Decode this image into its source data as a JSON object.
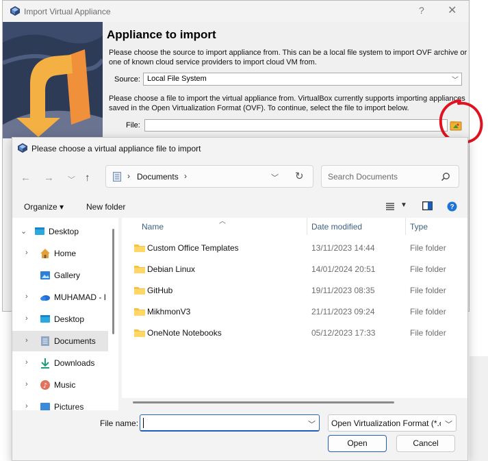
{
  "wizard": {
    "title": "Import Virtual Appliance",
    "help_label": "?",
    "close_label": "✕",
    "heading": "Appliance to import",
    "source_description": "Please choose the source to import appliance from. This can be a local file system to import OVF archive or one of known cloud service providers to import cloud VM from.",
    "source_label": "Source:",
    "source_value": "Local File System",
    "file_description": "Please choose a file to import the virtual appliance from. VirtualBox currently supports importing appliances saved in the Open Virtualization Format (OVF). To continue, select the file to import below.",
    "file_label": "File:",
    "file_value": ""
  },
  "file_dialog": {
    "title": "Please choose a virtual appliance file to import",
    "address": {
      "location": "Documents"
    },
    "search": {
      "placeholder": "Search Documents"
    },
    "toolbar": {
      "organize_label": "Organize ▾",
      "new_folder_label": "New folder"
    },
    "nav_pane": {
      "items": [
        {
          "label": "Desktop",
          "icon": "desktop-icon",
          "selected": false
        },
        {
          "label": "Home",
          "icon": "home-icon",
          "selected": false
        },
        {
          "label": "Gallery",
          "icon": "gallery-icon",
          "selected": false
        },
        {
          "label": "MUHAMAD - I",
          "icon": "onedrive-cloud-icon",
          "selected": false
        },
        {
          "label": "Desktop",
          "icon": "desktop-icon",
          "selected": false
        },
        {
          "label": "Documents",
          "icon": "documents-icon",
          "selected": true
        },
        {
          "label": "Downloads",
          "icon": "downloads-icon",
          "selected": false
        },
        {
          "label": "Music",
          "icon": "music-icon",
          "selected": false
        },
        {
          "label": "Pictures",
          "icon": "pictures-icon",
          "selected": false
        }
      ]
    },
    "columns": {
      "name": "Name",
      "date_modified": "Date modified",
      "type": "Type"
    },
    "files": [
      {
        "name": "Custom Office Templates",
        "date": "13/11/2023 14:44",
        "type": "File folder"
      },
      {
        "name": "Debian Linux",
        "date": "14/01/2024 20:51",
        "type": "File folder"
      },
      {
        "name": "GitHub",
        "date": "19/11/2023 08:35",
        "type": "File folder"
      },
      {
        "name": "MikhmonV3",
        "date": "21/11/2023 09:24",
        "type": "File folder"
      },
      {
        "name": "OneNote Notebooks",
        "date": "05/12/2023 17:33",
        "type": "File folder"
      }
    ],
    "filename_label": "File name:",
    "filename_value": "",
    "filetype_value": "Open Virtualization Format (*.o",
    "open_label": "Open",
    "cancel_label": "Cancel"
  },
  "colors": {
    "accent": "#0067c0",
    "folder": "#f5c342",
    "annotation": "#e0121f",
    "art_bg": "#2e3b57",
    "art_orange": "#f4a53b"
  }
}
